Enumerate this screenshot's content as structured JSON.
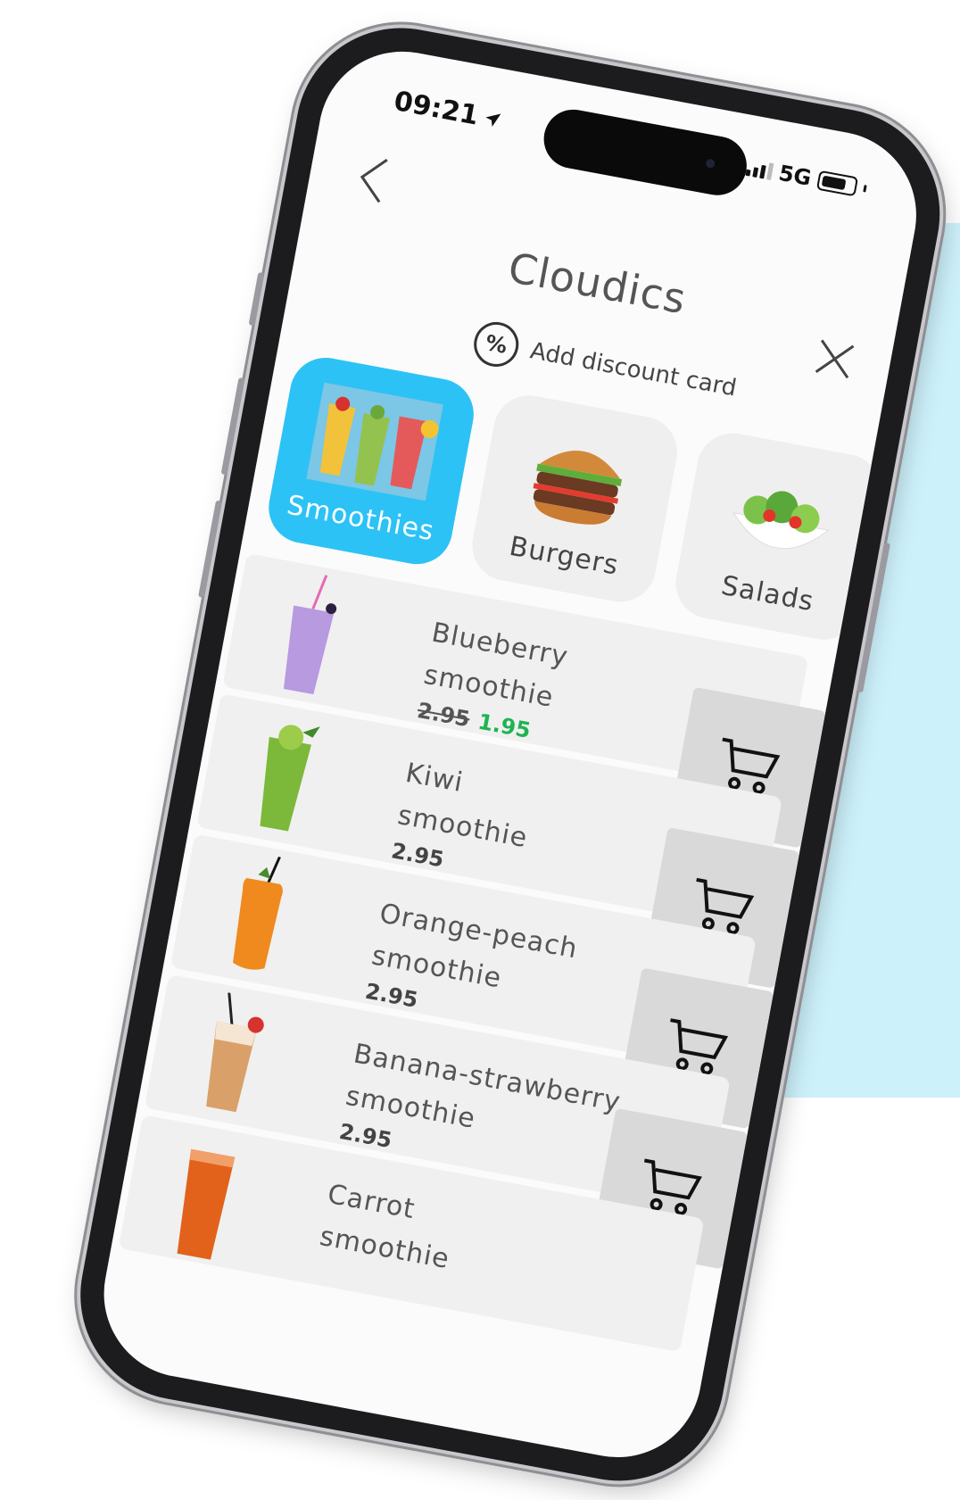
{
  "status": {
    "time": "09:21",
    "network": "5G"
  },
  "header": {
    "title": "Cloudics"
  },
  "discount": {
    "label": "Add discount card",
    "icon": "percent-icon"
  },
  "categories": [
    {
      "label": "Smoothies",
      "active": true
    },
    {
      "label": "Burgers",
      "active": false
    },
    {
      "label": "Salads",
      "active": false
    }
  ],
  "products": [
    {
      "line1": "Blueberry",
      "line2": "smoothie",
      "price": "2.95",
      "new_price": "1.95",
      "discounted": true,
      "color": "#b79adf"
    },
    {
      "line1": "Kiwi",
      "line2": "smoothie",
      "price": "2.95",
      "discounted": false,
      "color": "#7cb83a"
    },
    {
      "line1": "Orange-peach",
      "line2": "smoothie",
      "price": "2.95",
      "discounted": false,
      "color": "#f08a1e"
    },
    {
      "line1": "Banana-strawberry",
      "line2": "smoothie",
      "price": "2.95",
      "discounted": false,
      "color": "#d9a06a"
    },
    {
      "line1": "Carrot",
      "line2": "smoothie",
      "price": "",
      "discounted": false,
      "color": "#e2621c"
    }
  ],
  "colors": {
    "accent": "#2cc2f5",
    "discount_price": "#1fb351",
    "background_panel": "#cdf1fb"
  }
}
